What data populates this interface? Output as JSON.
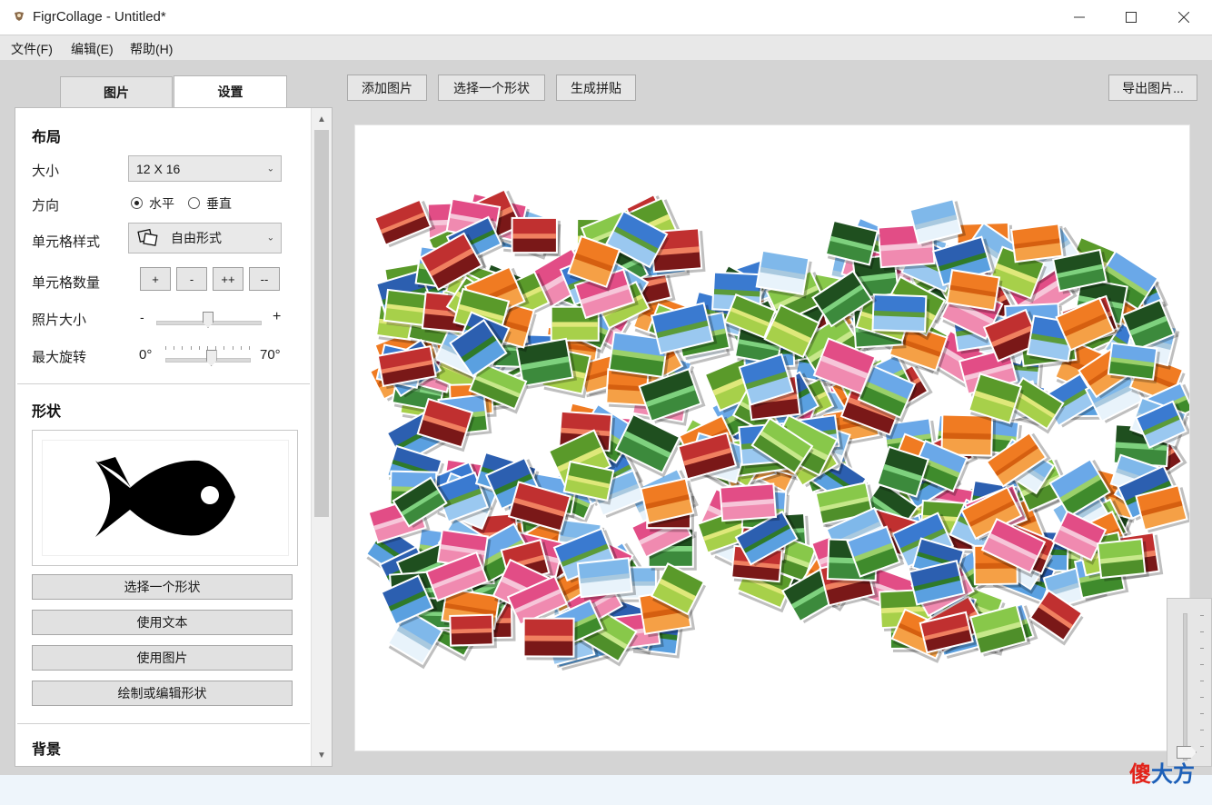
{
  "window": {
    "title": "FigrCollage - Untitled*",
    "minimize_icon": "minimize-icon",
    "maximize_icon": "maximize-icon",
    "close_icon": "close-icon"
  },
  "menu": {
    "file": "文件(F)",
    "edit": "编辑(E)",
    "help": "帮助(H)"
  },
  "tabs": {
    "pictures": "图片",
    "settings": "设置"
  },
  "toolbar": {
    "add_pictures": "添加图片",
    "choose_shape": "选择一个形状",
    "generate": "生成拼贴",
    "export": "导出图片..."
  },
  "layout": {
    "heading": "布局",
    "size_label": "大小",
    "size_value": "12 X 16",
    "direction_label": "方向",
    "horizontal": "水平",
    "vertical": "垂直",
    "direction_selected": "水平",
    "cell_style_label": "单元格样式",
    "cell_style_value": "自由形式",
    "cell_count_label": "单元格数量",
    "cell_buttons": [
      "+",
      "-",
      "++",
      "--"
    ],
    "photo_size_label": "照片大小",
    "photo_size_min": "-",
    "photo_size_max": "+",
    "photo_size_level": 0.5,
    "rotation_label": "最大旋转",
    "rotation_min": "0°",
    "rotation_max": "70°",
    "rotation_level": 0.55
  },
  "shape": {
    "heading": "形状",
    "choose": "选择一个形状",
    "use_text": "使用文本",
    "use_image": "使用图片",
    "draw_edit": "绘制或编辑形状"
  },
  "background": {
    "heading": "背景"
  },
  "watermark": {
    "part1": "傻",
    "part2": "大方"
  },
  "colors": {
    "accent_red": "#e2231a",
    "accent_blue": "#1c5fb8"
  }
}
